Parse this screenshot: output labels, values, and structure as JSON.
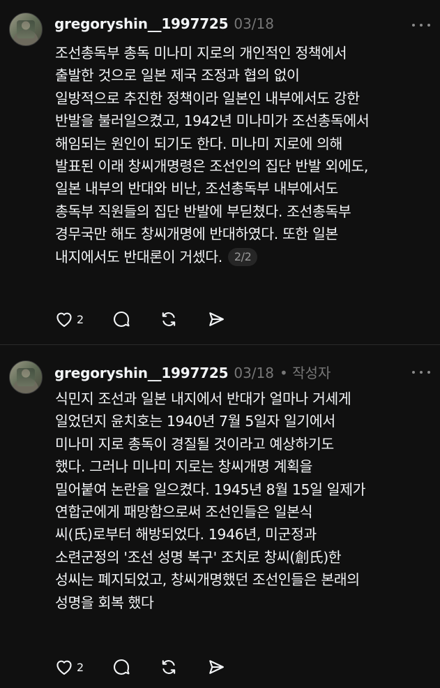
{
  "posts": [
    {
      "username": "gregoryshin__1997725",
      "date": "03/18",
      "author_tag": "",
      "lines": [
        "조선총독부 총독 미나미 지로의 개인적인 정책에서",
        "출발한 것으로 일본 제국 조정과 협의 없이",
        "일방적으로 추진한 정책이라 일본인 내부에서도 강한",
        "반발을 불러일으켰고, 1942년 미나미가 조선총독에서",
        "해임되는 원인이 되기도 한다. 미나미 지로에 의해",
        "발표된 이래 창씨개명령은 조선인의 집단 반발 외에도,",
        "일본 내부의 반대와 비난, 조선총독부 내부에서도",
        "총독부 직원들의 집단 반발에 부딛쳤다. 조선총독부",
        "경무국만 해도 창씨개명에 반대하였다. 또한 일본",
        "내지에서도 반대론이 거셌다."
      ],
      "pager": "2/2",
      "like_count": "2",
      "icons": [
        "heart-icon",
        "comment-icon",
        "repost-icon",
        "share-icon"
      ]
    },
    {
      "username": "gregoryshin__1997725",
      "date": "03/18",
      "author_tag": "• 작성자",
      "lines": [
        "식민지 조선과 일본 내지에서 반대가 얼마나 거세게",
        "일었던지 윤치호는 1940년 7월 5일자 일기에서",
        "미나미 지로 총독이 경질될 것이라고 예상하기도",
        "했다. 그러나 미나미 지로는 창씨개명 계획을",
        "밀어붙여 논란을 일으켰다. 1945년 8월 15일 일제가",
        "연합군에게 패망함으로써 조선인들은 일본식",
        "씨(氏)로부터 해방되었다. 1946년, 미군정과",
        "소련군정의 '조선 성명 복구' 조치로 창씨(創氏)한",
        "성씨는 폐지되었고, 창씨개명했던 조선인들은 본래의",
        "성명을 회복 했다"
      ],
      "pager": "",
      "like_count": "2",
      "icons": [
        "heart-icon",
        "comment-icon",
        "repost-icon",
        "share-icon"
      ]
    }
  ],
  "colors": {
    "background": "#101010",
    "text": "#f3f5f7",
    "muted": "#777777",
    "pill": "#262626"
  }
}
